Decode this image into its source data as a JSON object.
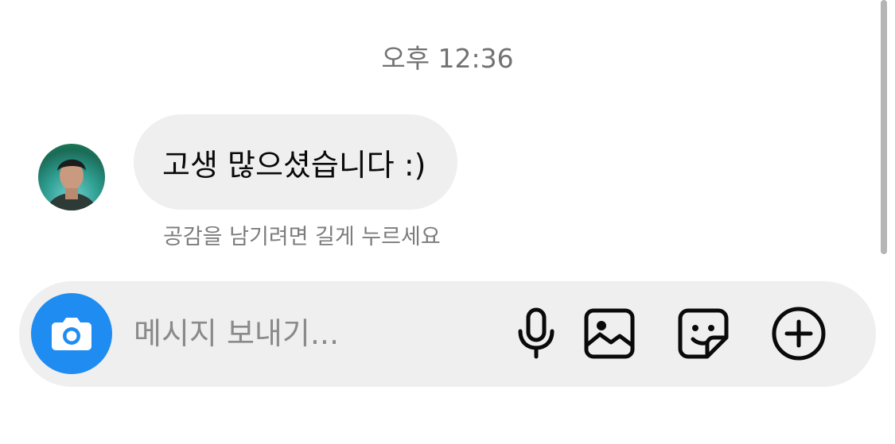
{
  "thread": {
    "timestamp": "오후 12:36",
    "messages": [
      {
        "sender_avatar": "avatar-icon",
        "text": "고생 많으셨습니다 :)",
        "reaction_hint": "공감을 남기려면 길게 누르세요"
      }
    ]
  },
  "composer": {
    "placeholder": "메시지 보내기...",
    "value": "",
    "camera_icon": "camera-icon",
    "tools": [
      "microphone-icon",
      "image-icon",
      "sticker-icon",
      "add-icon"
    ]
  },
  "colors": {
    "accent": "#1f8cf1",
    "bubble_bg": "#efefef",
    "secondary_text": "#727272"
  }
}
